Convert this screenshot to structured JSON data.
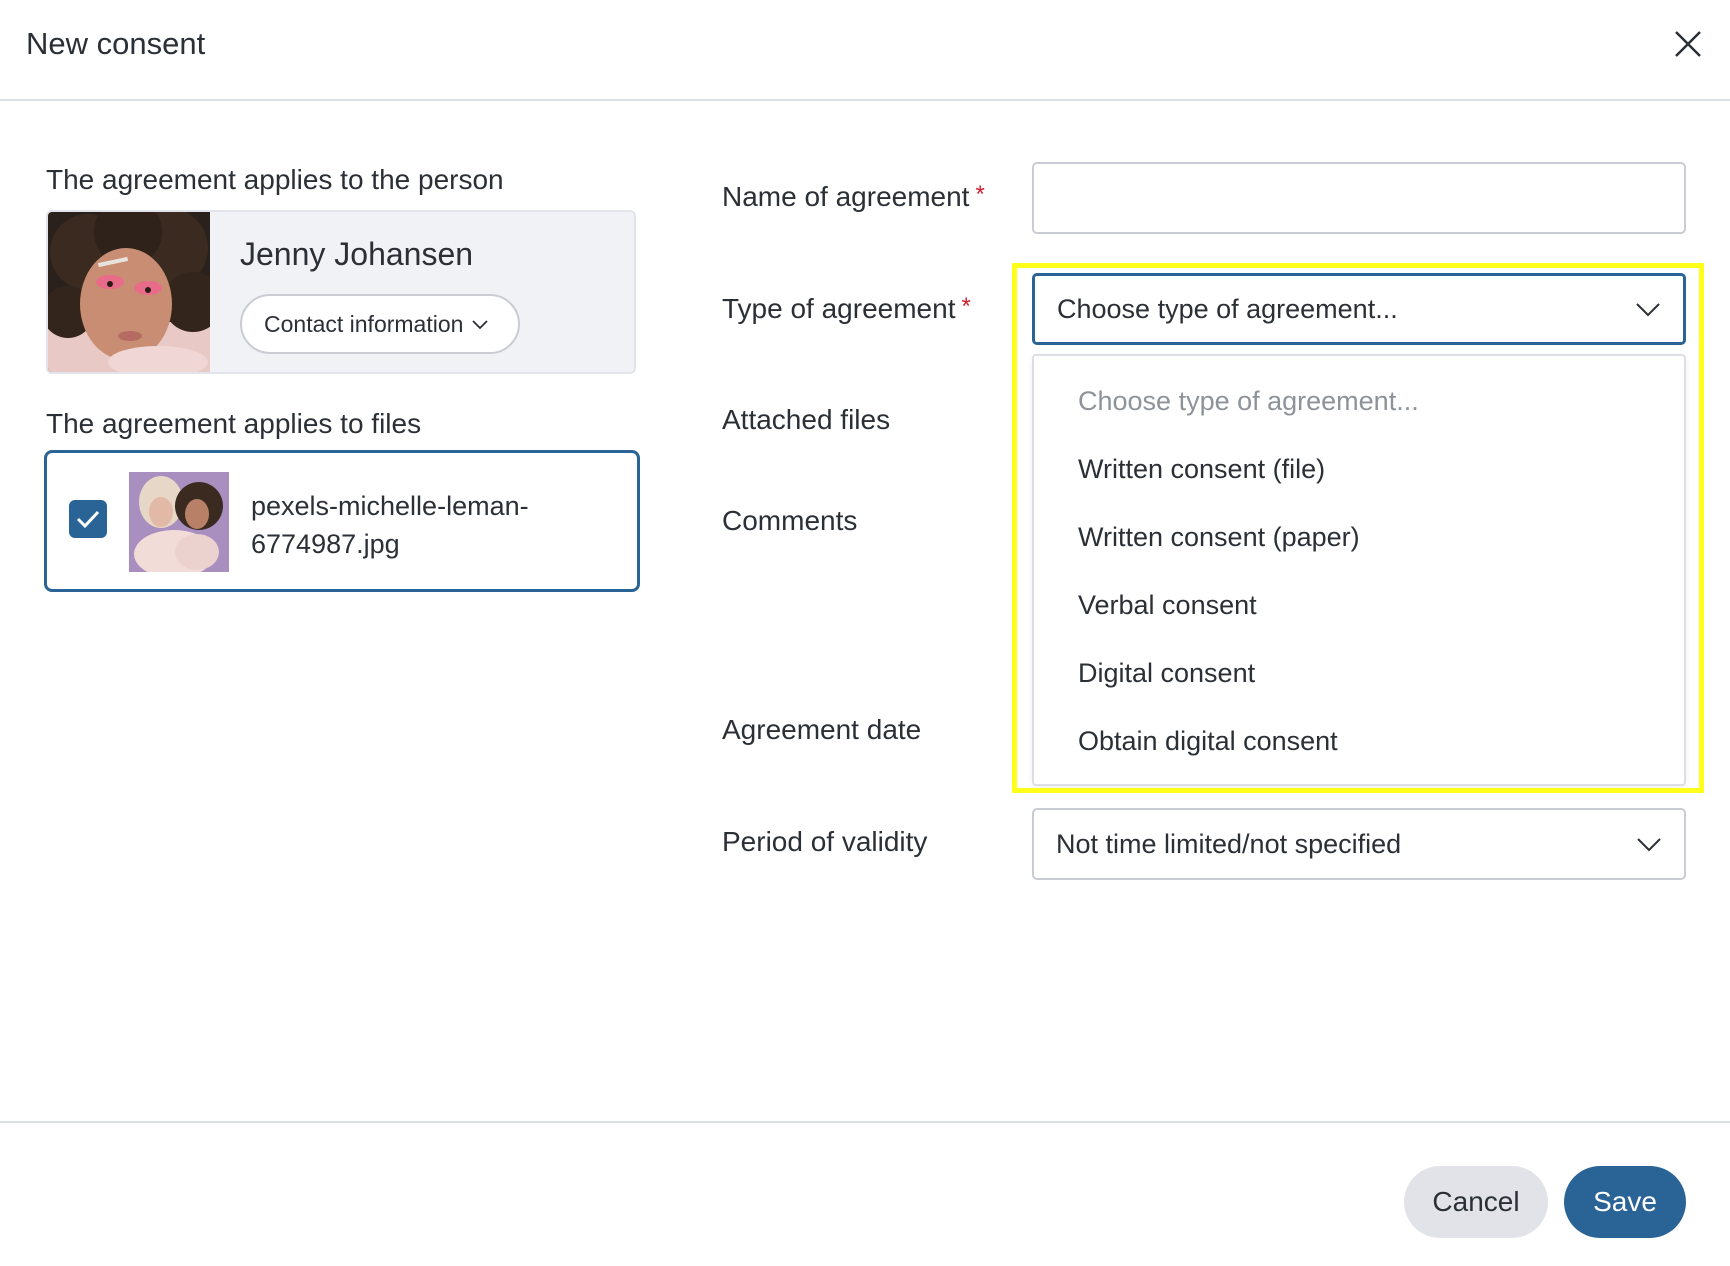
{
  "dialog": {
    "title": "New consent"
  },
  "person_section": {
    "label": "The agreement applies to the person",
    "name": "Jenny Johansen",
    "contact_button_label": "Contact information"
  },
  "files_section": {
    "label": "The agreement applies to files",
    "file": {
      "name": "pexels-michelle-leman-6774987.jpg",
      "checked": true
    }
  },
  "form": {
    "name_label": "Name of agreement",
    "name_value": "",
    "type_label": "Type of agreement",
    "type_selected": "Choose type of agreement...",
    "attached_files_label": "Attached files",
    "comments_label": "Comments",
    "agreement_date_label": "Agreement date",
    "validity_label": "Period of validity",
    "validity_selected": "Not time limited/not specified",
    "required_marker": "*"
  },
  "dropdown": {
    "options": [
      "Choose type of agreement...",
      "Written consent (file)",
      "Written consent (paper)",
      "Verbal consent",
      "Digital consent",
      "Obtain digital consent"
    ]
  },
  "footer": {
    "cancel_label": "Cancel",
    "save_label": "Save"
  },
  "colors": {
    "primary": "#2a6496",
    "required": "#d0202e",
    "highlight": "#ffff1a"
  },
  "icons": [
    "close-icon",
    "chevron-down-icon",
    "checkmark-icon"
  ]
}
